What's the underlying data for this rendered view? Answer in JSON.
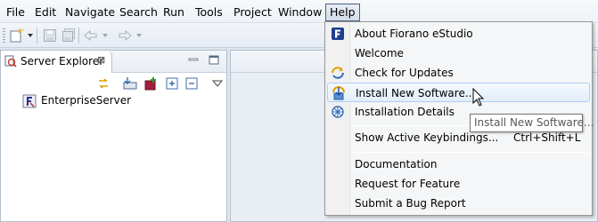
{
  "menubar": {
    "items": [
      {
        "label": "File"
      },
      {
        "label": "Edit"
      },
      {
        "label": "Navigate"
      },
      {
        "label": "Search"
      },
      {
        "label": "Run"
      },
      {
        "label": "Tools"
      },
      {
        "label": "Project"
      },
      {
        "label": "Window"
      },
      {
        "label": "Help"
      }
    ]
  },
  "toolbar": {
    "icons": [
      "new-wizard-icon",
      "save-icon",
      "save-all-icon",
      "back-icon",
      "forward-icon"
    ]
  },
  "server_explorer": {
    "tab_label": "Server Explorer",
    "close_glyph": "⊠",
    "tree": [
      {
        "label": "EnterpriseServer",
        "icon": "fiorano-server-icon"
      }
    ],
    "toolbar_icons": [
      "sync-icon",
      "import-icon",
      "add-server-icon",
      "expand-all-icon",
      "collapse-all-icon",
      "view-menu-icon"
    ]
  },
  "help_menu": {
    "items": [
      {
        "label": "About Fiorano eStudio",
        "icon": "fiorano-icon"
      },
      {
        "label": "Welcome",
        "icon": ""
      },
      {
        "label": "Check for Updates",
        "icon": "update-icon"
      },
      {
        "label": "Install New Software...",
        "icon": "install-icon"
      },
      {
        "label": "Installation Details",
        "icon": "installation-details-icon"
      },
      {
        "label": "Show Active Keybindings...",
        "accelerator": "Ctrl+Shift+L"
      },
      {
        "label": "Documentation"
      },
      {
        "label": "Request for Feature"
      },
      {
        "label": "Submit a Bug Report"
      }
    ]
  },
  "tooltip": {
    "text": "Install New Software..."
  }
}
